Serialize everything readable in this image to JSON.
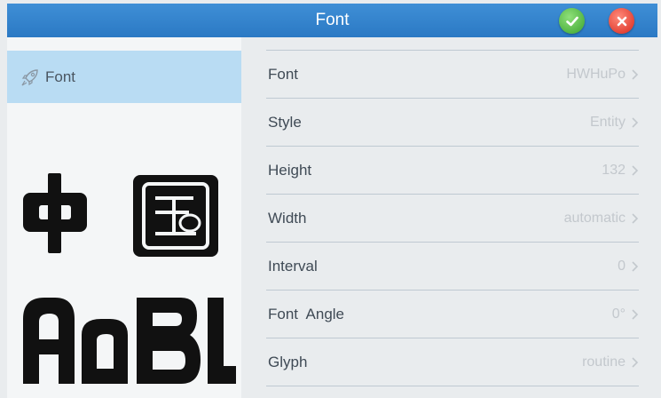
{
  "header": {
    "title": "Font",
    "confirm_icon": "check-icon",
    "cancel_icon": "close-icon"
  },
  "sidebar": {
    "tab": {
      "label": "Font",
      "icon": "rocket-icon"
    }
  },
  "preview": {
    "chars_line1": [
      "中",
      "国"
    ],
    "chars_line2": [
      "A",
      "a",
      "B",
      "l"
    ]
  },
  "settings": [
    {
      "label": "Font",
      "value": "HWHuPo"
    },
    {
      "label": "Style",
      "value": "Entity"
    },
    {
      "label": "Height",
      "value": "132"
    },
    {
      "label": "Width",
      "value": "automatic"
    },
    {
      "label": "Interval",
      "value": "0"
    },
    {
      "label": "Font  Angle",
      "value": "0°"
    },
    {
      "label": "Glyph",
      "value": "routine"
    }
  ],
  "colors": {
    "header": "#2f80cc",
    "confirm": "#4caf3e",
    "cancel": "#e0362a",
    "selected_tab": "#b9dcf3"
  }
}
